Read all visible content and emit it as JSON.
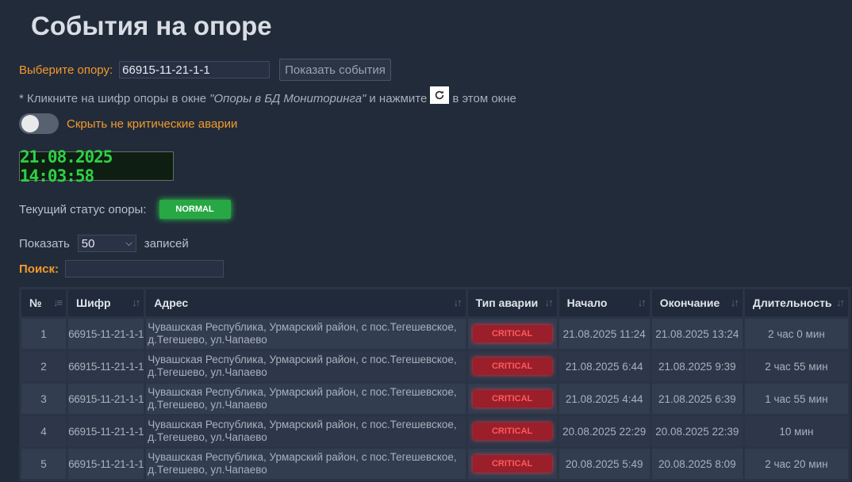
{
  "page": {
    "title": "События на опоре"
  },
  "selector": {
    "label": "Выберите опору:",
    "value": "66915-11-21-1-1",
    "show_button": "Показать события"
  },
  "hint": {
    "prefix": "* Кликните на шифр опоры в окне",
    "window_name": "\"Опоры в БД Мониторинга\"",
    "middle": "и нажмите",
    "suffix": "в этом окне",
    "icon": "refresh-icon"
  },
  "toggle": {
    "label": "Скрыть не критические аварии",
    "checked": false
  },
  "clock": {
    "value": "21.08.2025 14:03:58"
  },
  "status": {
    "label": "Текущий статус опоры:",
    "value": "NORMAL"
  },
  "length_menu": {
    "prefix": "Показать",
    "selected": "50",
    "suffix": "записей"
  },
  "search": {
    "label": "Поиск:",
    "value": ""
  },
  "table": {
    "columns": [
      "№",
      "Шифр",
      "Адрес",
      "Тип аварии",
      "Начало",
      "Окончание",
      "Длительность"
    ],
    "rows": [
      {
        "n": "1",
        "cipher": "66915-11-21-1-1",
        "address": "Чувашская Республика, Урмарский район, с пос.Тегешевское, д.Тегешево, ул.Чапаево",
        "type": "CRITICAL",
        "start": "21.08.2025 11:24",
        "end": "21.08.2025 13:24",
        "duration": "2 час 0 мин"
      },
      {
        "n": "2",
        "cipher": "66915-11-21-1-1",
        "address": "Чувашская Республика, Урмарский район, с пос.Тегешевское, д.Тегешево, ул.Чапаево",
        "type": "CRITICAL",
        "start": "21.08.2025 6:44",
        "end": "21.08.2025 9:39",
        "duration": "2 час 55 мин"
      },
      {
        "n": "3",
        "cipher": "66915-11-21-1-1",
        "address": "Чувашская Республика, Урмарский район, с пос.Тегешевское, д.Тегешево, ул.Чапаево",
        "type": "CRITICAL",
        "start": "21.08.2025 4:44",
        "end": "21.08.2025 6:39",
        "duration": "1 час 55 мин"
      },
      {
        "n": "4",
        "cipher": "66915-11-21-1-1",
        "address": "Чувашская Республика, Урмарский район, с пос.Тегешевское, д.Тегешево, ул.Чапаево",
        "type": "CRITICAL",
        "start": "20.08.2025 22:29",
        "end": "20.08.2025 22:39",
        "duration": "10 мин"
      },
      {
        "n": "5",
        "cipher": "66915-11-21-1-1",
        "address": "Чувашская Республика, Урмарский район, с пос.Тегешевское, д.Тегешево, ул.Чапаево",
        "type": "CRITICAL",
        "start": "20.08.2025 5:49",
        "end": "20.08.2025 8:09",
        "duration": "2 час 20 мин"
      }
    ]
  },
  "colors": {
    "background": "#222b3a",
    "accent": "#f39a2c",
    "normal": "#27a844",
    "critical": "#9a1f2b",
    "clock": "#30d046"
  }
}
